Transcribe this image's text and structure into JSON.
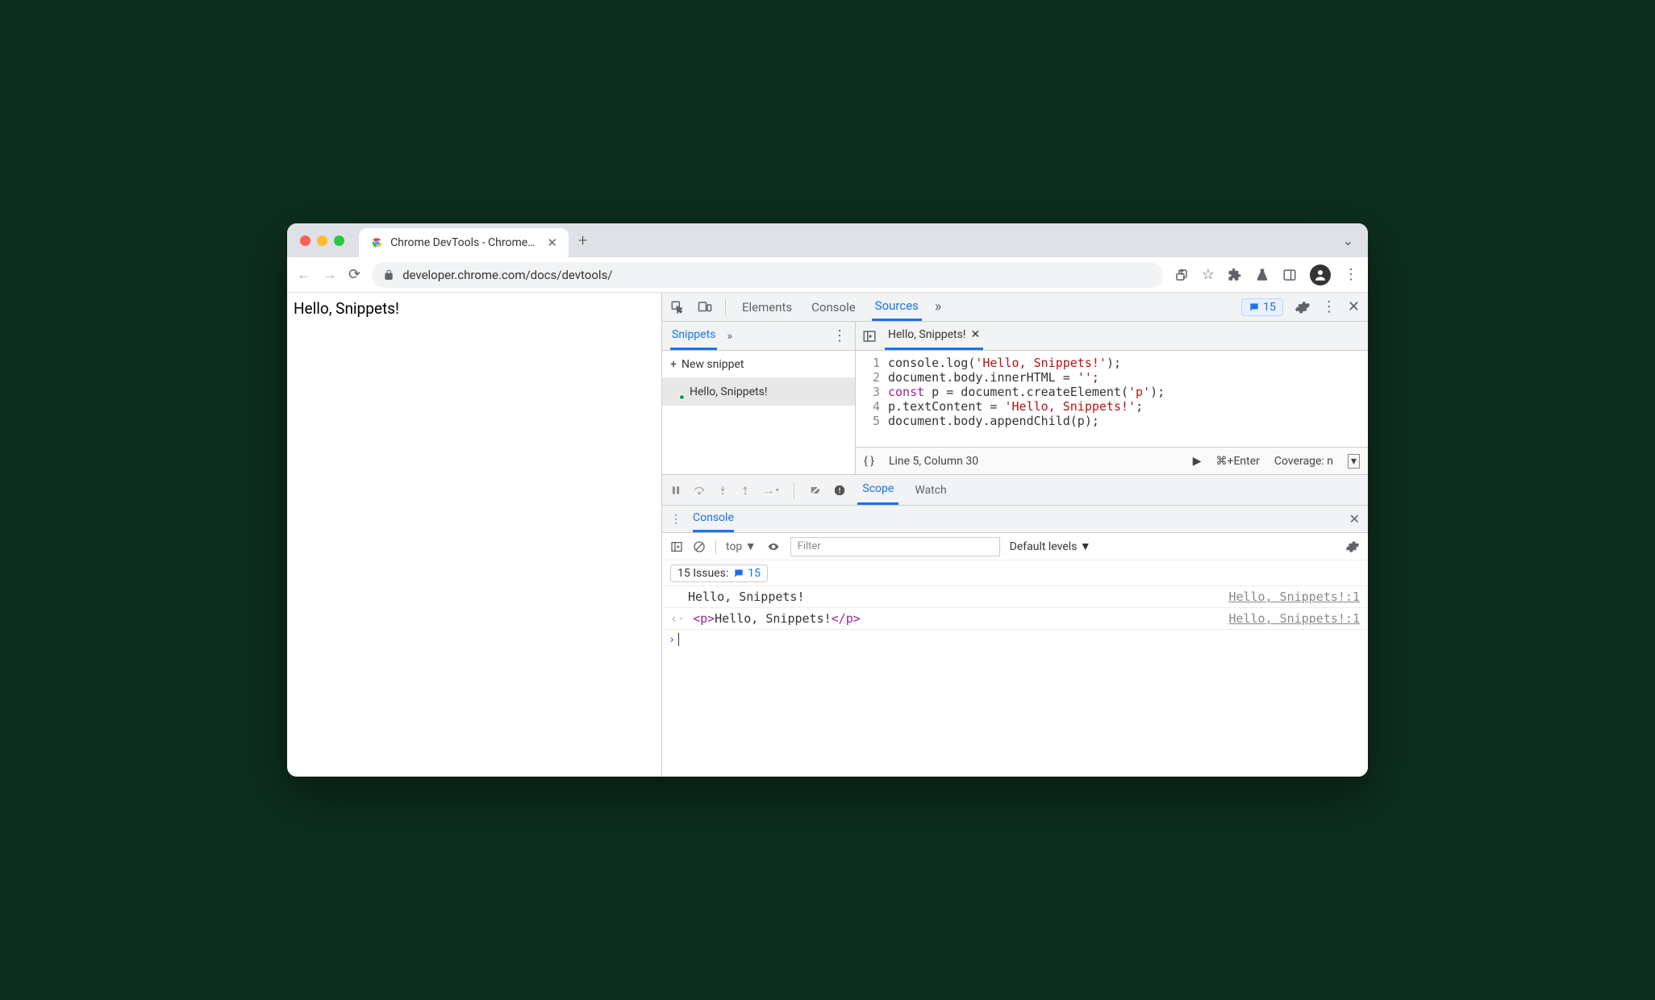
{
  "tab": {
    "title": "Chrome DevTools - Chrome De"
  },
  "url": "developer.chrome.com/docs/devtools/",
  "page_text": "Hello, Snippets!",
  "devtools": {
    "tabs": {
      "elements": "Elements",
      "console": "Console",
      "sources": "Sources"
    },
    "issue_count": "15",
    "snippets": {
      "label": "Snippets",
      "new_label": "New snippet",
      "item": "Hello, Snippets!"
    },
    "editor": {
      "filename": "Hello, Snippets!",
      "lines": [
        {
          "n": "1",
          "html": "console.log(<span class='str'>'Hello, Snippets!'</span>);"
        },
        {
          "n": "2",
          "html": "document.body.innerHTML = <span class='str'>''</span>;"
        },
        {
          "n": "3",
          "html": "<span class='kw'>const</span> p = document.createElement(<span class='str'>'p'</span>);"
        },
        {
          "n": "4",
          "html": "p.textContent = <span class='str'>'Hello, Snippets!'</span>;"
        },
        {
          "n": "5",
          "html": "document.body.appendChild(p);"
        }
      ],
      "status_pos": "Line 5, Column 30",
      "run_hint": "⌘+Enter",
      "coverage": "Coverage: n"
    },
    "debug_tabs": {
      "scope": "Scope",
      "watch": "Watch"
    },
    "drawer": {
      "label": "Console",
      "context": "top",
      "filter_placeholder": "Filter",
      "levels": "Default levels",
      "issues_label": "15 Issues:",
      "issues_count": "15",
      "logs": [
        {
          "text": "Hello, Snippets!",
          "src": "Hello, Snippets!:1",
          "html": false
        },
        {
          "text": "<span class='tag'>&lt;p&gt;</span>Hello, Snippets!<span class='tag'>&lt;/p&gt;</span>",
          "src": "Hello, Snippets!:1",
          "html": true,
          "return": true
        }
      ]
    }
  }
}
